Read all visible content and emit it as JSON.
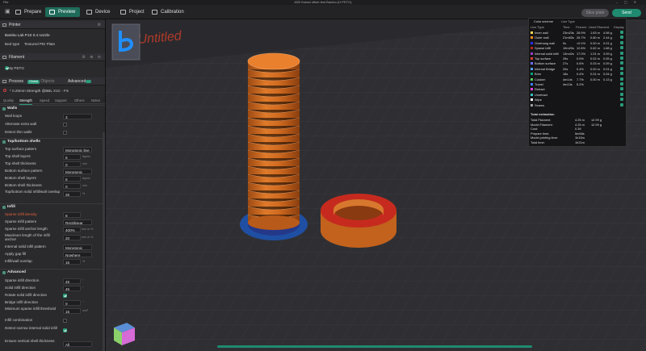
{
  "titlebar": {
    "app": "File",
    "title": "M20 thread offset test Bambu (H PETG)"
  },
  "tabs": [
    {
      "label": "Prepare"
    },
    {
      "label": "Preview"
    },
    {
      "label": "Device"
    },
    {
      "label": "Project"
    },
    {
      "label": "Calibration"
    }
  ],
  "actions": {
    "slice_label": "Slice plate",
    "send_label": "Send"
  },
  "printer": {
    "header": "Printer",
    "name": "Bambu Lab P1S 0.4 nozzle",
    "bed_label": "Bed type",
    "bed_value": "Textured PEI Plate"
  },
  "filament": {
    "header": "Filament",
    "item": "My PETG"
  },
  "process": {
    "header": "Process",
    "badge": "Global",
    "objects": "Objects",
    "advanced": "Advanced",
    "profile": "* 0.20mm Strength @BBL X1C - FS"
  },
  "proc_tabs": [
    "Quality",
    "Strength",
    "Speed",
    "Support",
    "Others",
    "Notes"
  ],
  "walls": {
    "title": "Walls",
    "wall_loops_label": "Wall loops",
    "wall_loops": "3",
    "alt_extra_label": "Alternate extra wall",
    "detect_thin_label": "Detect thin walls"
  },
  "shells": {
    "title": "Top/bottom shells",
    "top_pattern_label": "Top surface pattern",
    "top_pattern": "Monotonic line",
    "top_layers_label": "Top shell layers",
    "top_layers": "5",
    "top_thick_label": "Top shell thickness",
    "top_thick": "0",
    "bottom_pattern_label": "Bottom surface pattern",
    "bottom_pattern": "Monotonic",
    "bottom_layers_label": "Bottom shell layers",
    "bottom_layers": "5",
    "bottom_thick_label": "Bottom shell thickness",
    "bottom_thick": "0",
    "overlap_label": "Top/bottom solid infill/wall overlap",
    "overlap": "25",
    "unit_layers": "layers",
    "unit_mm": "mm",
    "unit_pct": "%"
  },
  "infill": {
    "title": "Infill",
    "density_label": "Sparse infill density",
    "density": "8",
    "pattern_label": "Sparse infill pattern",
    "pattern": "Rectilinear",
    "anchor_label": "Sparse infill anchor length",
    "anchor": "400%",
    "anchor_max_label": "Maximum length of the infill anchor",
    "anchor_max": "20",
    "internal_label": "Internal solid infill pattern",
    "internal": "Monotonic",
    "gap_label": "Apply gap fill",
    "gap": "Nowhere",
    "wall_overlap_label": "Infill/wall overlap",
    "wall_overlap": "15",
    "unit_anchor": "mm or %"
  },
  "advanced": {
    "title": "Advanced",
    "sparse_dir_label": "Sparse infill direction",
    "sparse_dir": "45",
    "solid_dir_label": "Solid infill direction",
    "solid_dir": "45",
    "rotate_label": "Rotate solid infill direction",
    "bridge_dir_label": "Bridge infill direction",
    "bridge_dir": "0",
    "min_area_label": "Minimum sparse infill threshold",
    "min_area": "15",
    "combination_label": "Infill combination",
    "detect_narrow_label": "Detect narrow internal solid infill",
    "ensure_label": "Ensure vertical shell thickness",
    "ensure": "All",
    "unit_deg": "°",
    "unit_mm2": "mm²"
  },
  "legend": {
    "scheme_label": "Color scheme",
    "scheme_value": "Line Type",
    "headers": [
      "Line Type",
      "Time",
      "Percent",
      "Used Filament",
      "Display"
    ],
    "rows": [
      {
        "name": "Inner wall",
        "time": "23m23s",
        "pct": "28.9%",
        "len": "1.63 m",
        "g": "4.98 g",
        "color": "#ffd84c"
      },
      {
        "name": "Outer wall",
        "time": "21m50s",
        "pct": "26.7%",
        "len": "0.80 m",
        "g": "2.44 g",
        "color": "#ff8c1f"
      },
      {
        "name": "Overhang wall",
        "time": "0s",
        "pct": "<0.1%",
        "len": "0.00 m",
        "g": "0.01 g",
        "color": "#2d2dff"
      },
      {
        "name": "Sparse infill",
        "time": "10m20s",
        "pct": "12.8%",
        "len": "0.62 m",
        "g": "1.88 g",
        "color": "#b3261e"
      },
      {
        "name": "Internal solid infill",
        "time": "13m42s",
        "pct": "17.0%",
        "len": "1.01 m",
        "g": "3.09 g",
        "color": "#9b3ec9"
      },
      {
        "name": "Top surface",
        "time": "25s",
        "pct": "0.5%",
        "len": "0.02 m",
        "g": "0.05 g",
        "color": "#e03a2f"
      },
      {
        "name": "Bottom surface",
        "time": "27s",
        "pct": "0.6%",
        "len": "0.03 m",
        "g": "0.09 g",
        "color": "#6e6eff"
      },
      {
        "name": "Internal Bridge",
        "time": "20s",
        "pct": "0.4%",
        "len": "0.00 m",
        "g": "0.01 g",
        "color": "#4fa3ff"
      },
      {
        "name": "Brim",
        "time": "18s",
        "pct": "0.4%",
        "len": "0.01 m",
        "g": "0.04 g",
        "color": "#00a87b"
      },
      {
        "name": "Custom",
        "time": "4m14s",
        "pct": "7.7%",
        "len": "0.00 m",
        "g": "0.13 g",
        "color": "#5ad05a"
      },
      {
        "name": "Travel",
        "time": "4m13s",
        "pct": "5.2%",
        "len": "",
        "g": "",
        "color": "#3f7fff"
      },
      {
        "name": "Retract",
        "time": "",
        "pct": "",
        "len": "",
        "g": "",
        "color": "#e040e0"
      },
      {
        "name": "Unretract",
        "time": "",
        "pct": "",
        "len": "",
        "g": "",
        "color": "#37c0c0"
      },
      {
        "name": "Wipe",
        "time": "",
        "pct": "",
        "len": "",
        "g": "",
        "color": "#ffffff"
      },
      {
        "name": "Seams",
        "time": "",
        "pct": "",
        "len": "",
        "g": "",
        "color": "#a0a0a0"
      }
    ],
    "estimation_title": "Total estimation",
    "estimation": [
      {
        "label": "Total Filament:",
        "val1": "4.25 m",
        "val2": "12.99 g"
      },
      {
        "label": "Model Filament:",
        "val1": "4.25 m",
        "val2": "12.99 g"
      },
      {
        "label": "Cost:",
        "val1": "0.39",
        "val2": ""
      },
      {
        "label": "Prepare time:",
        "val1": "5m58s",
        "val2": ""
      },
      {
        "label": "Model printing time:",
        "val1": "1h15m",
        "val2": ""
      },
      {
        "label": "Total time:",
        "val1": "1h21m",
        "val2": ""
      }
    ]
  },
  "bed_text": "Untitled",
  "colors": {
    "accent": "#1f8a70",
    "model_orange": "#d46a1f",
    "model_red": "#b3261e",
    "brim_blue": "#1f4fa3"
  }
}
